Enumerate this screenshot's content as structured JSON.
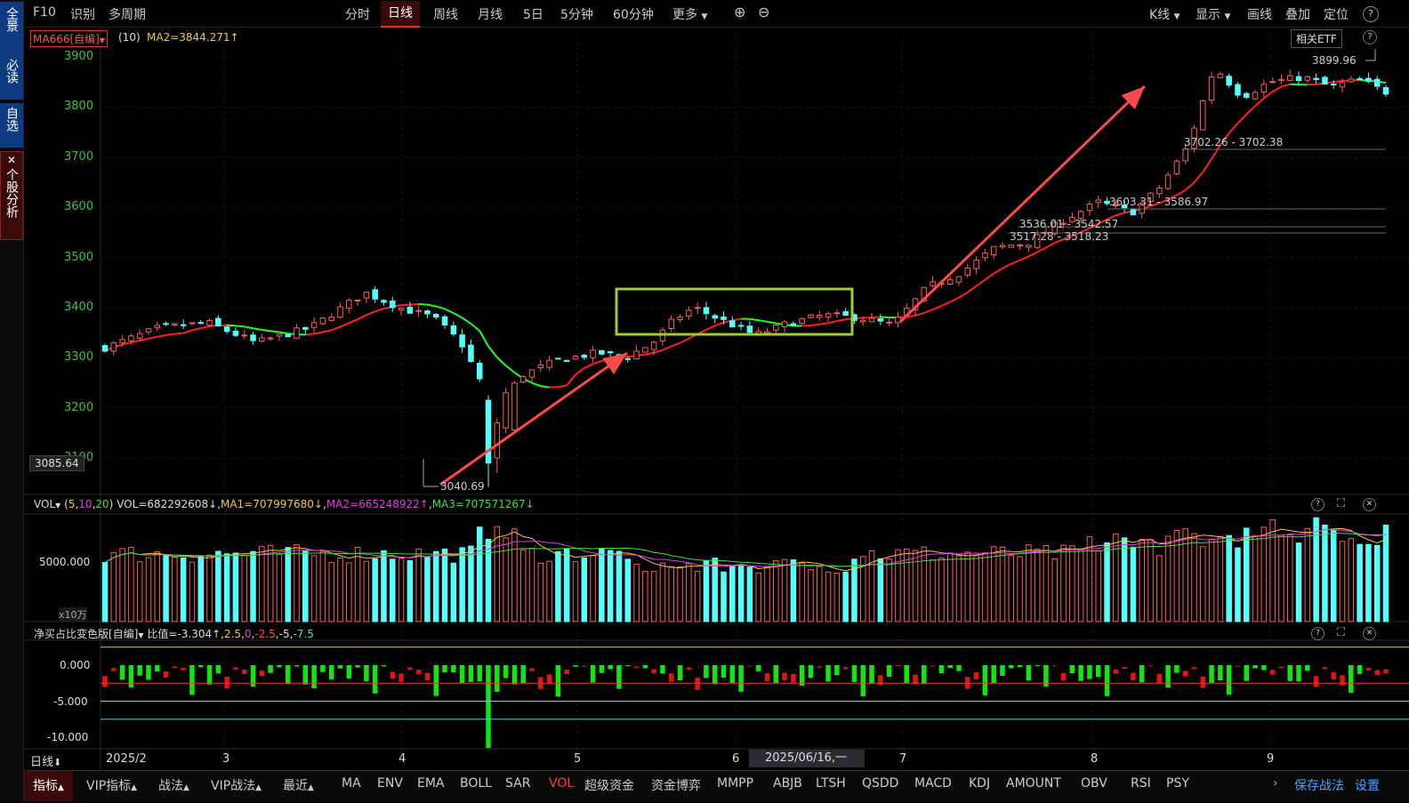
{
  "sidebar": [
    {
      "label": "全景"
    },
    {
      "label": "必读"
    },
    {
      "label": "自选"
    },
    {
      "label": "个股分析",
      "close": "✕"
    }
  ],
  "topbar": {
    "f10": "F10",
    "identify": "识别",
    "multi_period": "多周期",
    "periods": [
      "分时",
      "日线",
      "周线",
      "月线",
      "5日",
      "5分钟",
      "60分钟",
      "更多"
    ],
    "active_period": "日线",
    "zoom_in": "⊕",
    "zoom_out": "⊖",
    "right": [
      "K线",
      "显示",
      "画线",
      "叠加",
      "定位"
    ],
    "help": "?"
  },
  "main_panel": {
    "indicator_name": "MA666[自编]",
    "indicator_param": "(10)",
    "ma2": "MA2=3844.271↑",
    "etf_button": "相关ETF",
    "y_ticks": [
      "3900",
      "3800",
      "3700",
      "3600",
      "3500",
      "3400",
      "3300",
      "3200",
      "3100"
    ],
    "crosshair_value": "3085.64",
    "low_label": "3040.69",
    "high_label": "3899.96",
    "gap_labels": [
      "3702.26 - 3702.38",
      "3603.31 - 3586.97",
      "3536.01 - 3542.57",
      "3517.28 - 3518.23"
    ]
  },
  "vol_panel": {
    "name": "VOL",
    "params_prefix": "(",
    "p1": "5",
    "p2": "10",
    "p3": "20",
    "params_suffix": ")",
    "vol": "VOL=682292608↓",
    "ma1": "MA1=707997680↓",
    "ma2": "MA2=665248922↑",
    "ma3": "MA3=707571267↓",
    "y_tick": "5000.000",
    "unit": "x10万"
  },
  "net_panel": {
    "name": "净买占比变色版[自编]",
    "ratio": "比值=-3.304↑",
    "p1": "2.5",
    "p2": "0",
    "p3": "-2.5",
    "p4": "-5",
    "p5": "-7.5",
    "y_ticks": [
      "0.000",
      "-5.000",
      "-10.000"
    ]
  },
  "xaxis": {
    "period": "日线",
    "labels": [
      "2025/2",
      "3",
      "4",
      "5",
      "6",
      "7",
      "8",
      "9"
    ],
    "cursor_date": "2025/06/16,一"
  },
  "bottombar": {
    "left": [
      "指标",
      "VIP指标",
      "战法",
      "VIP战法",
      "最近"
    ],
    "indicators": [
      "MA",
      "ENV",
      "EMA",
      "BOLL",
      "SAR",
      "VOL",
      "超级资金",
      "资金博弈",
      "MMPP",
      "ABJB",
      "LTSH",
      "QSDD",
      "MACD",
      "KDJ",
      "AMOUNT",
      "OBV",
      "RSI",
      "PSY"
    ],
    "active": "VOL",
    "save": "保存战法",
    "settings": "设置"
  },
  "colors": {
    "up": "#ff5b5b",
    "down": "#54ffff",
    "ma_red": "#ff2020",
    "ma_green": "#20ff20",
    "highlight_box": "#9acd32",
    "arrow": "#ff4a4a"
  }
}
